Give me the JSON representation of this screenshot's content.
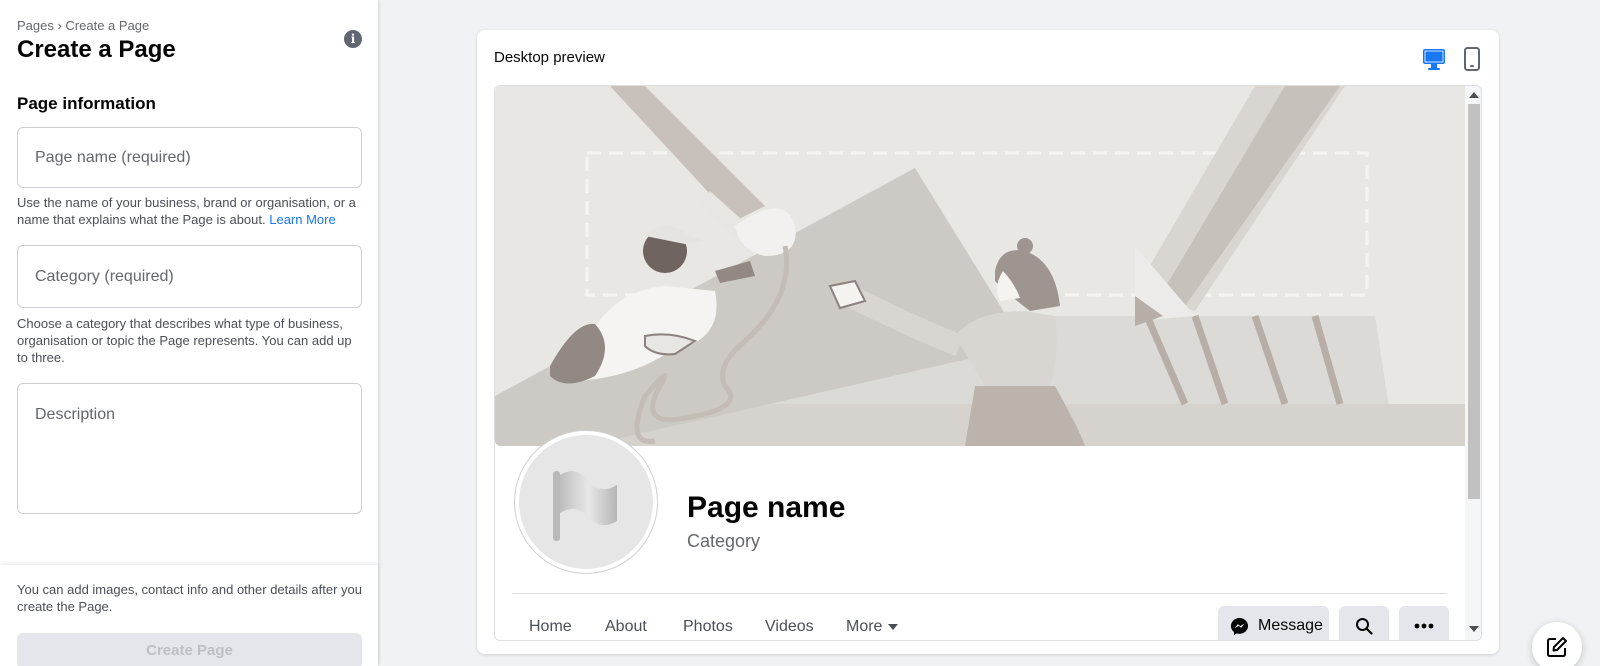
{
  "left_panel": {
    "breadcrumb": "Pages › Create a Page",
    "title": "Create a Page",
    "section_title": "Page information",
    "page_name_placeholder": "Page name (required)",
    "page_name_help": "Use the name of your business, brand or organisation, or a name that explains what the Page is about.",
    "learn_more": "Learn More",
    "category_placeholder": "Category (required)",
    "category_help": "Choose a category that describes what type of business, organisation or topic the Page represents. You can add up to three.",
    "description_placeholder": "Description",
    "footer_note": "You can add images, contact info and other details after you create the Page.",
    "create_button": "Create Page"
  },
  "preview": {
    "title": "Desktop preview",
    "page_name": "Page name",
    "category": "Category",
    "tabs": [
      "Home",
      "About",
      "Photos",
      "Videos",
      "More"
    ],
    "message_button": "Message"
  },
  "colors": {
    "accent": "#1877f2",
    "cover_bg": "#e9e7e3",
    "disabled_text": "#bcc0c4"
  }
}
